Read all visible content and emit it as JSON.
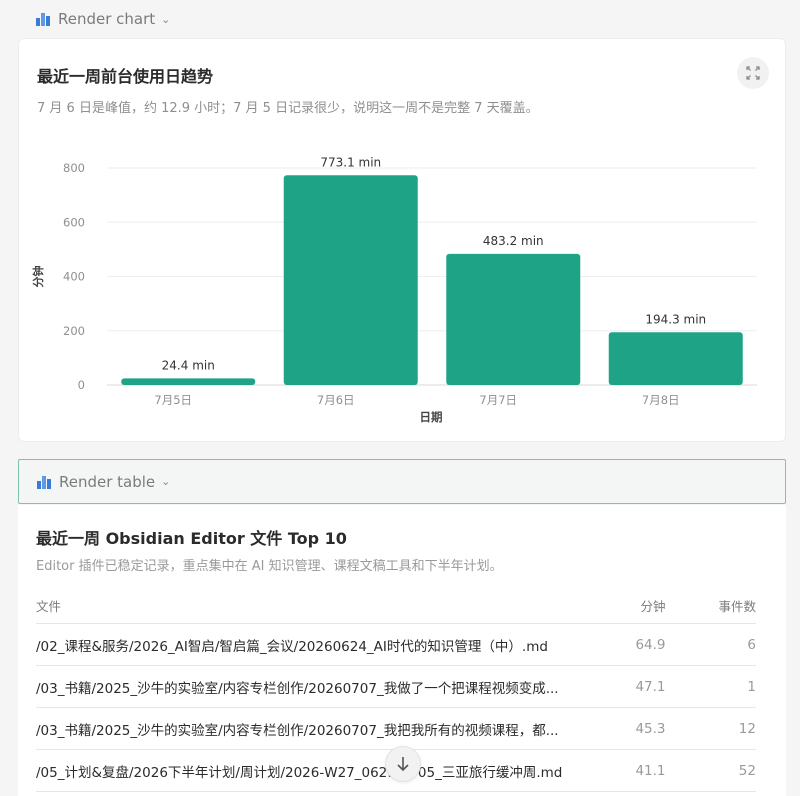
{
  "chart_block": {
    "header_label": "Render chart",
    "title": "最近一周前台使用日趋势",
    "subtitle": "7 月 6 日是峰值，约 12.9 小时；7 月 5 日记录很少，说明这一周不是完整 7 天覆盖。"
  },
  "chart_data": {
    "type": "bar",
    "categories": [
      "7月5日",
      "7月6日",
      "7月7日",
      "7月8日"
    ],
    "values": [
      24.4,
      773.1,
      483.2,
      194.3
    ],
    "data_labels": [
      "24.4 min",
      "773.1 min",
      "483.2 min",
      "194.3 min"
    ],
    "xlabel": "日期",
    "ylabel": "分钟",
    "ylim": [
      0,
      800
    ],
    "yticks": [
      0,
      200,
      400,
      600,
      800
    ],
    "bar_color": "#1fa386",
    "grid": true,
    "legend": "none"
  },
  "table_block": {
    "header_label": "Render table",
    "title": "最近一周 Obsidian Editor 文件 Top 10",
    "subtitle": "Editor 插件已稳定记录，重点集中在 AI 知识管理、课程文稿工具和下半年计划。",
    "columns": {
      "file": "文件",
      "minutes": "分钟",
      "events": "事件数"
    },
    "rows": [
      {
        "file": "/02_课程&服务/2026_AI智启/智启篇_会议/20260624_AI时代的知识管理（中）.md",
        "minutes": "64.9",
        "events": "6"
      },
      {
        "file": "/03_书籍/2025_沙牛的实验室/内容专栏创作/20260707_我做了一个把课程视频变成...",
        "minutes": "47.1",
        "events": "1"
      },
      {
        "file": "/03_书籍/2025_沙牛的实验室/内容专栏创作/20260707_我把我所有的视频课程，都...",
        "minutes": "45.3",
        "events": "12"
      },
      {
        "file": "/05_计划&复盘/2026下半年计划/周计划/2026-W27_0629-0705_三亚旅行缓冲周.md",
        "minutes": "41.1",
        "events": "52"
      }
    ]
  },
  "colors": {
    "accent": "#1fa386",
    "selected_border": "#7cc3a9"
  }
}
